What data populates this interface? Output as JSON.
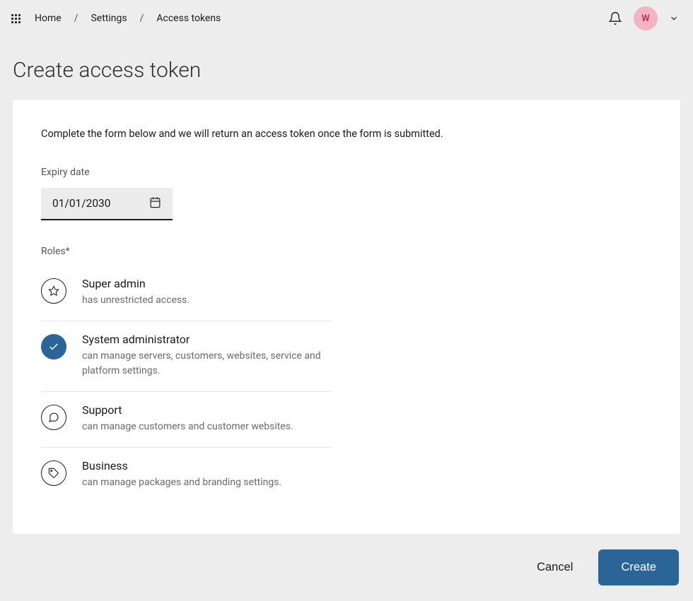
{
  "header": {
    "breadcrumbs": [
      "Home",
      "Settings",
      "Access tokens"
    ],
    "avatar_initial": "W"
  },
  "page": {
    "title": "Create access token"
  },
  "form": {
    "instructions": "Complete the form below and we will return an access token once the form is submitted.",
    "expiry": {
      "label": "Expiry date",
      "value": "01/01/2030"
    },
    "roles": {
      "label": "Roles*",
      "items": [
        {
          "icon": "star",
          "name": "Super admin",
          "desc": "has unrestricted access.",
          "selected": false
        },
        {
          "icon": "check",
          "name": "System administrator",
          "desc": "can manage servers, customers, websites, service and platform settings.",
          "selected": true
        },
        {
          "icon": "chat",
          "name": "Support",
          "desc": "can manage customers and customer websites.",
          "selected": false
        },
        {
          "icon": "tag",
          "name": "Business",
          "desc": "can manage packages and branding settings.",
          "selected": false
        }
      ]
    }
  },
  "footer": {
    "cancel_label": "Cancel",
    "create_label": "Create"
  }
}
